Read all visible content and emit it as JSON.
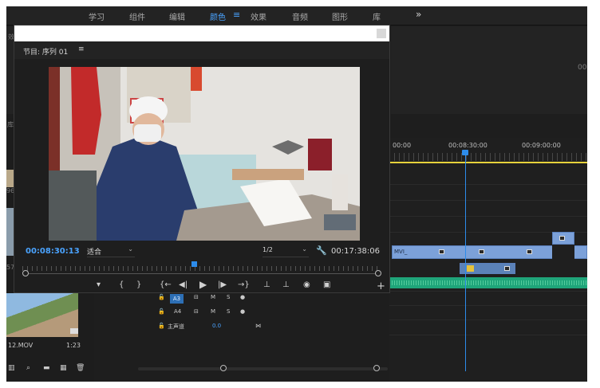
{
  "workspace": {
    "tabs": [
      "学习",
      "组件",
      "编辑",
      "颜色",
      "效果",
      "音频",
      "图形",
      "库"
    ],
    "active": "颜色",
    "menu_glyph": "≡",
    "more_glyph": "»"
  },
  "background": {
    "top_left_label": "效",
    "right_label": "00",
    "lib_label": "库",
    "side_label_1": "96.",
    "side_label_2": "57."
  },
  "program_monitor": {
    "title": "节目: 序列 01",
    "menu_glyph": "≡",
    "current_timecode": "00:08:30:13",
    "fit_select": "适合",
    "resolution_select": "1/2",
    "duration": "00:17:38:06",
    "transport": {
      "marker": "▾",
      "in_point": "{",
      "out_point": "}",
      "go_to_in": "{←",
      "step_back": "◀|",
      "play": "▶",
      "step_forward": "|▶",
      "go_to_out": "→}",
      "lift": "⊥",
      "extract": "⊥",
      "export_frame": "◉",
      "compare": "▣",
      "add": "+"
    }
  },
  "timeline": {
    "tc_labels": [
      "00:00",
      "00:08:30:00",
      "00:09:00:00"
    ],
    "video_clip_label": "MVI_",
    "clip_icon_glyph": "fx"
  },
  "audio_tracks": [
    {
      "name": "A3",
      "m": "M",
      "s": "S"
    },
    {
      "name": "A4",
      "m": "M",
      "s": "S"
    }
  ],
  "master": {
    "name": "主声道",
    "value": "0.0"
  },
  "bin": {
    "file_name": "12.MOV",
    "duration": "1:23"
  },
  "colors": {
    "accent": "#4aa3ff",
    "playhead": "#2d8ceb",
    "work_area": "#e6d23b",
    "audio": "#1fa57a",
    "video_clip": "#7ca1d9"
  }
}
